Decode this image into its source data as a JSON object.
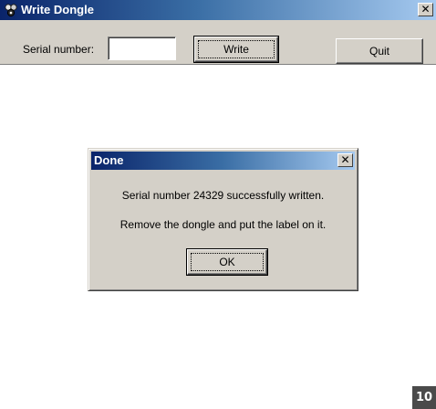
{
  "window": {
    "title": "Write Dongle",
    "icon": "dongle-app-icon",
    "close_glyph": "✕"
  },
  "toolbar": {
    "serial_label": "Serial number:",
    "serial_value": "",
    "write_label": "Write",
    "quit_label": "Quit"
  },
  "dialog": {
    "title": "Done",
    "close_glyph": "✕",
    "message_line1": "Serial number 24329 successfully written.",
    "message_line2": "Remove the dongle and put the label on it.",
    "ok_label": "OK"
  },
  "page_number": "10",
  "colors": {
    "titlebar_start": "#0a246a",
    "titlebar_end": "#a6caf0",
    "face": "#d4d0c8"
  }
}
